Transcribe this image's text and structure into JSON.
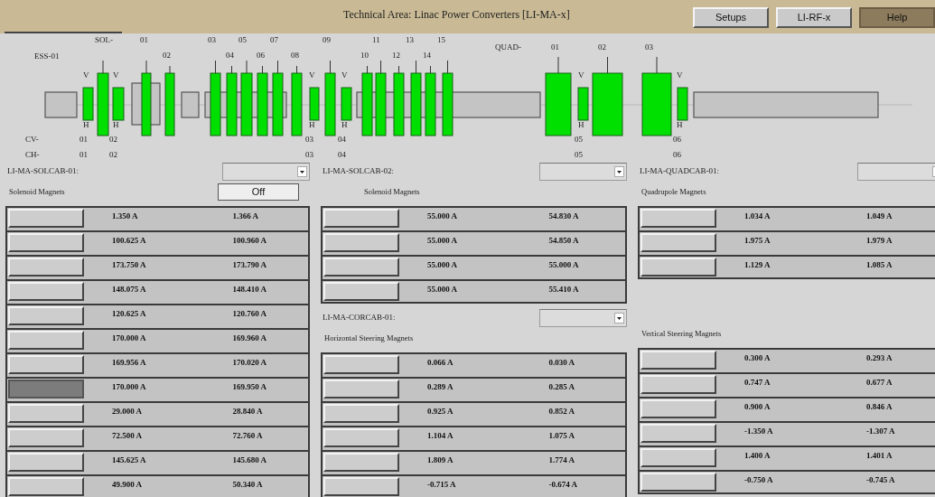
{
  "window": {
    "title": "Technical Area: Linac Power Converters [LI-MA-x]"
  },
  "toolbar_buttons": [
    {
      "label": "Setups",
      "kind": "normal"
    },
    {
      "label": "LI-RF-x",
      "kind": "normal"
    },
    {
      "label": "Help",
      "kind": "help"
    }
  ],
  "beamline": {
    "ess_label": "ESS-01",
    "sol_prefix": "SOL-",
    "sol_numbers": [
      "01",
      "02",
      "03",
      "04",
      "05",
      "06",
      "07",
      "08",
      "09",
      "10",
      "11",
      "12",
      "13",
      "14",
      "15"
    ],
    "quad_prefix": "QUAD-",
    "quad_numbers": [
      "01",
      "02",
      "03"
    ],
    "v_labels": [
      "V",
      "V",
      "V",
      "V",
      "V",
      "V"
    ],
    "h_labels": [
      "H",
      "H",
      "H",
      "H",
      "H",
      "H"
    ],
    "cv_prefix": "CV-",
    "cv_numbers": [
      "01",
      "02",
      "03",
      "04",
      "05",
      "06"
    ],
    "ch_prefix": "CH-",
    "ch_numbers": [
      "01",
      "02",
      "03",
      "04",
      "05",
      "06"
    ]
  },
  "panels": [
    {
      "sections": [
        {
          "cabinet": "LI-MA-SOLCAB-01:",
          "title": "Solenoid Magnets",
          "button": "Off",
          "rows": [
            {
              "setpoint": "1.350 A",
              "readback": "1.366 A",
              "pressed": false
            },
            {
              "setpoint": "100.625 A",
              "readback": "100.960 A",
              "pressed": false
            },
            {
              "setpoint": "173.750 A",
              "readback": "173.790 A",
              "pressed": false
            },
            {
              "setpoint": "148.075 A",
              "readback": "148.410 A",
              "pressed": false
            },
            {
              "setpoint": "120.625 A",
              "readback": "120.760 A",
              "pressed": false
            },
            {
              "setpoint": "170.000 A",
              "readback": "169.960 A",
              "pressed": false
            },
            {
              "setpoint": "169.956 A",
              "readback": "170.020 A",
              "pressed": false
            },
            {
              "setpoint": "170.000 A",
              "readback": "169.950 A",
              "pressed": true
            },
            {
              "setpoint": "29.000 A",
              "readback": "28.840 A",
              "pressed": false
            },
            {
              "setpoint": "72.500 A",
              "readback": "72.760 A",
              "pressed": false
            },
            {
              "setpoint": "145.625 A",
              "readback": "145.680 A",
              "pressed": false
            },
            {
              "setpoint": "49.900 A",
              "readback": "50.340 A",
              "pressed": false
            }
          ]
        }
      ]
    },
    {
      "sections": [
        {
          "cabinet": "LI-MA-SOLCAB-02:",
          "title": "Solenoid Magnets",
          "rows": [
            {
              "setpoint": "55.000 A",
              "readback": "54.830 A",
              "pressed": false
            },
            {
              "setpoint": "55.000 A",
              "readback": "54.850 A",
              "pressed": false
            },
            {
              "setpoint": "55.000 A",
              "readback": "55.000 A",
              "pressed": false
            },
            {
              "setpoint": "55.000 A",
              "readback": "55.410 A",
              "pressed": false
            }
          ]
        },
        {
          "cabinet": "LI-MA-CORCAB-01:",
          "title": "Horizontal Steering Magnets",
          "rows": [
            {
              "setpoint": "0.066 A",
              "readback": "0.030 A",
              "pressed": false
            },
            {
              "setpoint": "0.289 A",
              "readback": "0.285 A",
              "pressed": false
            },
            {
              "setpoint": "0.925 A",
              "readback": "0.852 A",
              "pressed": false
            },
            {
              "setpoint": "1.104 A",
              "readback": "1.075 A",
              "pressed": false
            },
            {
              "setpoint": "1.809 A",
              "readback": "1.774 A",
              "pressed": false
            },
            {
              "setpoint": "-0.715 A",
              "readback": "-0.674 A",
              "pressed": false
            }
          ]
        }
      ]
    },
    {
      "sections": [
        {
          "cabinet": "LI-MA-QUADCAB-01:",
          "title": "Quadrupole Magnets",
          "rows": [
            {
              "setpoint": "1.034 A",
              "readback": "1.049 A",
              "pressed": false
            },
            {
              "setpoint": "1.975 A",
              "readback": "1.979 A",
              "pressed": false
            },
            {
              "setpoint": "1.129 A",
              "readback": "1.085 A",
              "pressed": false
            }
          ]
        },
        {
          "title": "Vertical Steering Magnets",
          "rows": [
            {
              "setpoint": "0.300 A",
              "readback": "0.293 A",
              "pressed": false
            },
            {
              "setpoint": "0.747 A",
              "readback": "0.677 A",
              "pressed": false
            },
            {
              "setpoint": "0.900 A",
              "readback": "0.846 A",
              "pressed": false
            },
            {
              "setpoint": "-1.350 A",
              "readback": "-1.307 A",
              "pressed": false
            },
            {
              "setpoint": "1.400 A",
              "readback": "1.401 A",
              "pressed": false
            },
            {
              "setpoint": "-0.750 A",
              "readback": "-0.745 A",
              "pressed": false
            }
          ]
        }
      ]
    }
  ]
}
